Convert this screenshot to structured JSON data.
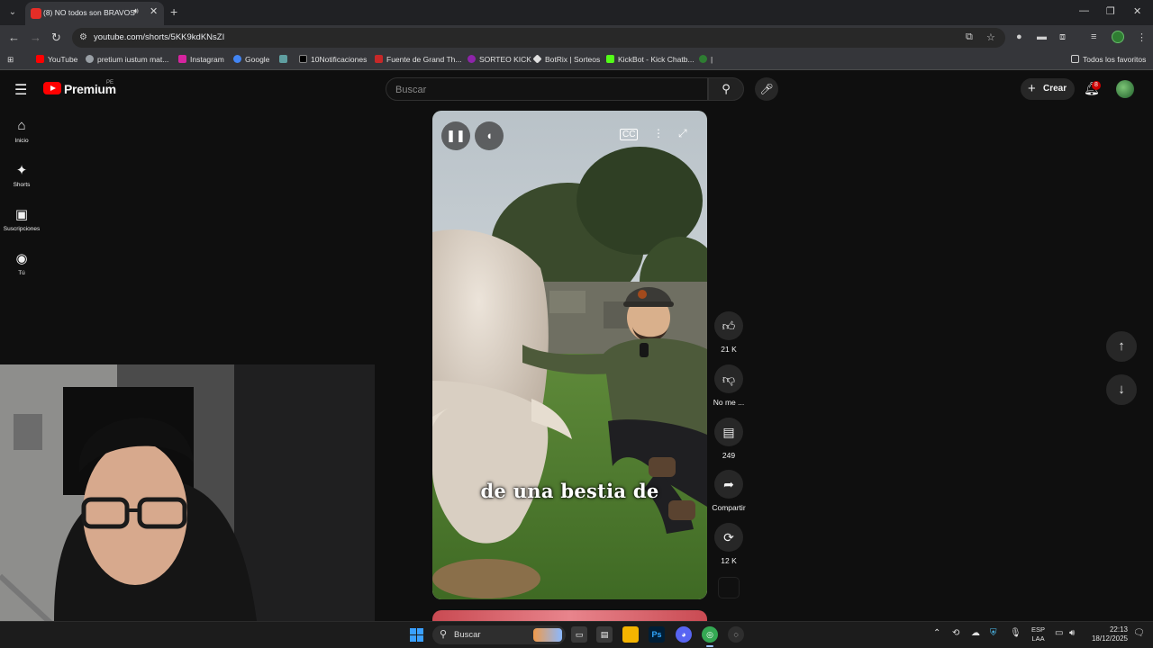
{
  "browser": {
    "tab_title": "(8) NO todos son BRAVOS 🐂 ...",
    "url": "youtube.com/shorts/5KK9kdKNsZI",
    "bookmarks": [
      {
        "label": "YouTube",
        "color": "#ff0000"
      },
      {
        "label": "pretium iustum mat...",
        "color": "#9aa0a6"
      },
      {
        "label": "Instagram",
        "color": "#d6249f"
      },
      {
        "label": "Google",
        "color": "#4285f4"
      },
      {
        "label": "",
        "color": "#5f9ea0"
      },
      {
        "label": "10Notificaciones",
        "color": "#000000"
      },
      {
        "label": "Fuente de Grand Th...",
        "color": "#c62828"
      },
      {
        "label": "SORTEO KICK",
        "color": "#8e24aa"
      },
      {
        "label": "BotRix | Sorteos",
        "color": "#e0e0e0"
      },
      {
        "label": "KickBot - Kick Chatb...",
        "color": "#53fc18"
      },
      {
        "label": "|",
        "color": "#2e7d32"
      }
    ],
    "all_bookmarks": "Todos los favoritos"
  },
  "masthead": {
    "brand": "Premium",
    "region": "PE",
    "search_placeholder": "Buscar",
    "create_label": "Crear",
    "notification_count": "8"
  },
  "guide": [
    {
      "label": "Inicio",
      "icon": "home-icon",
      "glyph": "⌂"
    },
    {
      "label": "Shorts",
      "icon": "shorts-icon",
      "glyph": "✦"
    },
    {
      "label": "Suscripciones",
      "icon": "subscriptions-icon",
      "glyph": "▣"
    },
    {
      "label": "Tú",
      "icon": "you-icon",
      "glyph": "◉"
    }
  ],
  "short": {
    "caption": "de una bestia de",
    "actions": {
      "like_count": "21 K",
      "dislike_label": "No me ...",
      "comment_count": "249",
      "share_label": "Compartir",
      "remix_count": "12 K"
    }
  },
  "taskbar": {
    "search_label": "Buscar",
    "lang_top": "ESP",
    "lang_bottom": "LAA",
    "time": "22:13",
    "date": "18/12/2025",
    "apps": [
      {
        "name": "task-view",
        "glyph": "▭",
        "color": "#3a3a3a"
      },
      {
        "name": "notepad",
        "glyph": "▤",
        "color": "#3a3a3a"
      },
      {
        "name": "file-explorer",
        "glyph": "",
        "color": "#f4b400"
      },
      {
        "name": "photoshop",
        "glyph": "Ps",
        "color": "#001e36"
      },
      {
        "name": "discord",
        "glyph": "◕",
        "color": "#5865f2"
      },
      {
        "name": "chrome",
        "glyph": "◎",
        "color": "#34a853"
      },
      {
        "name": "obs",
        "glyph": "◌",
        "color": "#2e2e2e"
      }
    ]
  },
  "colors": {
    "accent": "#ff0000",
    "background": "#0f0f0f"
  }
}
